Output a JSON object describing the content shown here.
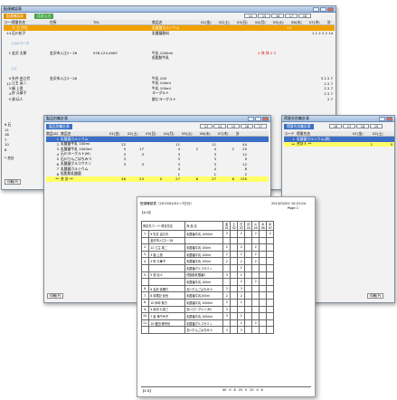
{
  "main_window": {
    "title": "配達確認表",
    "subtabs": [
      "配達確認表",
      "月次入力"
    ],
    "nav": [
      "14",
      "15",
      "16",
      "17",
      "18"
    ],
    "columns": [
      "コード",
      "得意先名",
      "住所",
      "TEL",
      "商品名",
      "01(金)",
      "02(土)",
      "03(日)",
      "04(月)",
      "05(火)",
      "06(水)",
      "07(木)",
      "計"
    ],
    "rows": [
      {
        "code": "",
        "name": "カ 主 仔也",
        "addr": "",
        "tel": "",
        "item": "乳酸菌カルシウム",
        "v": "14",
        "style": "orange"
      },
      {
        "code": "14",
        "name": "石川花子",
        "addr": "",
        "tel": "",
        "item": "乳酸菌飲料",
        "v": "1 1 2 2 2 14",
        "style": ""
      },
      {
        "code": "",
        "name": "[1]Aコース",
        "addr": "",
        "tel": "",
        "item": "",
        "v": "",
        "style": "group"
      },
      {
        "code": "1",
        "name": "金沢 太郎",
        "addr": "金沢市入江2－26",
        "tel": "076-123-4567",
        "item": "牛乳 1000ml",
        "v": "2 休 休 2 3",
        "style": ""
      },
      {
        "code": "",
        "name": "",
        "addr": "",
        "tel": "",
        "item": "低脂肪牛乳",
        "v": "",
        "style": ""
      },
      {
        "code": "",
        "name": "[1]",
        "addr": "",
        "tel": "",
        "item": "",
        "v": "",
        "style": "group"
      },
      {
        "code": "9",
        "name": "矢井 由江代",
        "addr": "金沢市入江2－26",
        "tel": "",
        "item": "牛乳 100",
        "v": "3 2 2 7",
        "style": ""
      },
      {
        "code": "12",
        "name": "江主 英二",
        "addr": "",
        "tel": "",
        "item": "牛乳 100ml",
        "v": "2 2 7",
        "style": ""
      },
      {
        "code": "3",
        "name": "福 上男",
        "addr": "",
        "tel": "",
        "item": "牛乳 100ml",
        "v": "2 2 7",
        "style": ""
      },
      {
        "code": "4",
        "name": "鈴 久華子",
        "addr": "",
        "tel": "",
        "item": "ヨーグルト",
        "v": "2 2 7",
        "style": ""
      },
      {
        "code": "5",
        "name": "須 伝人",
        "addr": "",
        "tel": "",
        "item": "飲むヨーグルト",
        "v": "2 7",
        "style": ""
      }
    ],
    "left_codes": [
      "6 石",
      "11",
      "18",
      "7",
      "10",
      "8 ",
      "* 合計"
    ],
    "print_button": "印刷(P)"
  },
  "middle_window": {
    "title": "製品別集計表",
    "subtab": "製品別集計表",
    "nav": [
      "13",
      "14",
      "15",
      "16",
      "17"
    ],
    "columns": [
      "商品CD",
      "商品名",
      "01(金)",
      "02(土)",
      "03(日)",
      "04(月)",
      "05(火)",
      "06(水)",
      "07(木)",
      "計"
    ],
    "rows": [
      {
        "cd": "1",
        "name": "乳酸菌カルシウム",
        "vals": [
          "",
          "",
          "",
          "",
          "",
          "",
          "",
          ""
        ],
        "style": "blue"
      },
      {
        "cd": "2",
        "name": "乳酸菌牛乳 100ml",
        "vals": [
          "22",
          "",
          "",
          "11",
          "",
          "11",
          "",
          "44"
        ],
        "style": ""
      },
      {
        "cd": "3",
        "name": "乳酸菌牛乳 1000ml",
        "vals": [
          "5",
          "17",
          "",
          "4",
          "2",
          "4",
          "2",
          "25"
        ],
        "style": ""
      },
      {
        "cd": "4",
        "name": "石川ヨーグルト(M)",
        "vals": [
          "3",
          "3",
          "",
          "3",
          "",
          "3",
          "",
          "12"
        ],
        "style": ""
      },
      {
        "cd": "5",
        "name": "石川りんごはちみつ",
        "vals": [
          "3",
          "",
          "",
          "3",
          "",
          "3",
          "",
          "9"
        ],
        "style": ""
      },
      {
        "cd": "6",
        "name": "乳酸菌グルコサミン",
        "vals": [
          "3",
          "3",
          "",
          "3",
          "",
          "3",
          "",
          "12"
        ],
        "style": ""
      },
      {
        "cd": "7",
        "name": "乳酸菌カルシウム",
        "vals": [
          "",
          "",
          "",
          "4",
          "",
          "4",
          "",
          "8"
        ],
        "style": ""
      },
      {
        "cd": "8",
        "name": "低脂肪乳酸菌",
        "vals": [
          "",
          "",
          "",
          "1",
          "",
          "1",
          "",
          "2"
        ],
        "style": ""
      },
      {
        "cd": "**",
        "name": "合 計 **",
        "vals": [
          "46",
          "23",
          "0",
          "27",
          "6",
          "27",
          "6",
          "135"
        ],
        "style": "yellow"
      }
    ],
    "print_button": "印刷(P)"
  },
  "right_window": {
    "title": "得意先別集計表",
    "subtab": "得意先別集計表",
    "nav": [
      "16",
      "17",
      "18",
      "19",
      "20"
    ],
    "columns": [
      "コード",
      "得意先名",
      "01(金)",
      "02(土)"
    ],
    "rows": [
      {
        "code": "1",
        "name": "乳酸菌カルシウム(朝)",
        "v1": "",
        "v2": "",
        "style": "blue"
      },
      {
        "code": "**",
        "name": "合計人 **",
        "v1": "1",
        "v2": "0",
        "style": "yellow"
      }
    ],
    "print_button": "印刷(P)"
  },
  "print_preview": {
    "title": "配達確認表（2013/02/01～7日分）",
    "date": "2013/02/01 10:21:04",
    "page": "Page 1",
    "section": "【A D】",
    "course": "得意先コード 得意先名",
    "col_item": "商 品 名",
    "days": [
      "金",
      "土",
      "日",
      "月",
      "火",
      "水",
      "木"
    ],
    "day_nums": [
      "01",
      "02",
      "03",
      "04",
      "05",
      "06",
      "07"
    ],
    "rows": [
      {
        "no": "1-",
        "name": "9 矢井 由江代",
        "item": "乳酸菌牛乳 1000ml",
        "v": [
          "3",
          "",
          "2",
          "",
          "2",
          "",
          "2"
        ]
      },
      {
        "no": "",
        "name": "金沢市入江2－26",
        "item": "",
        "v": [
          "",
          "",
          "",
          "",
          "",
          "",
          ""
        ]
      },
      {
        "no": "2-",
        "name": "12 江主 英二",
        "item": "乳酸菌牛乳 100ml",
        "v": [
          "2",
          "",
          "2",
          "",
          "2",
          "",
          ""
        ]
      },
      {
        "no": "3-",
        "name": "3 福 上男",
        "item": "乳酸菌牛乳 100ml",
        "v": [
          "2",
          "",
          "2",
          "",
          "2",
          "",
          ""
        ]
      },
      {
        "no": "4-",
        "name": "4 鈴 久華子",
        "item": "乳酸菌牛乳 100ml",
        "v": [
          "2",
          "",
          "2",
          "",
          "2",
          "",
          ""
        ]
      },
      {
        "no": "",
        "name": "",
        "item": "乳酸菌グルコサミン",
        "v": [
          "",
          "",
          "2",
          "",
          "",
          "",
          ""
        ]
      },
      {
        "no": "5-",
        "name": "5 須 伝人",
        "item": "低脂肪乳酸菌2",
        "v": [
          "3",
          "",
          "2",
          "",
          "",
          "",
          ""
        ]
      },
      {
        "no": "",
        "name": "",
        "item": "乳酸菌牛乳 100ml",
        "v": [
          "",
          "",
          "2",
          "",
          "2",
          "",
          ""
        ]
      },
      {
        "no": "6-",
        "name": "6 名前 真理乃",
        "item": "石川りんごはちみつ",
        "v": [
          "3",
          "",
          "3",
          "",
          "",
          "",
          ""
        ]
      },
      {
        "no": "7-",
        "name": "8 前尾記 紀也",
        "item": "乳酸菌牛乳100ml",
        "v": [
          "2",
          "",
          "2",
          "",
          "",
          "",
          ""
        ]
      },
      {
        "no": "8-",
        "name": "10 柿坪 紫乃",
        "item": "乳酸菌牛乳 1000ml",
        "v": [
          "3",
          "",
          "2",
          "",
          "",
          "",
          ""
        ]
      },
      {
        "no": "9-",
        "name": "4 永田 七恵三",
        "item": "石川ヨーグルト(M)",
        "v": [
          "3",
          "",
          "",
          "",
          "",
          "",
          ""
        ]
      },
      {
        "no": "10-",
        "name": "7 金 竜千代子",
        "item": "乳酸菌牛乳 1000ml",
        "v": [
          "3",
          "",
          "2",
          "",
          "",
          "",
          ""
        ]
      },
      {
        "no": "11-",
        "name": "10 蔵田 郁宗也",
        "item": "乳酸菌グルコサミン",
        "v": [
          "",
          "",
          "2",
          "",
          "2",
          "",
          ""
        ]
      },
      {
        "no": "",
        "name": "",
        "item": "石川りんごはちみつ",
        "v": [
          "3",
          "",
          "3",
          "",
          "",
          "",
          ""
        ]
      }
    ],
    "footer_section": "【A D】",
    "footer_totals": [
      "40",
      "0",
      "8",
      "25",
      "0",
      "25",
      "0",
      "6"
    ]
  }
}
